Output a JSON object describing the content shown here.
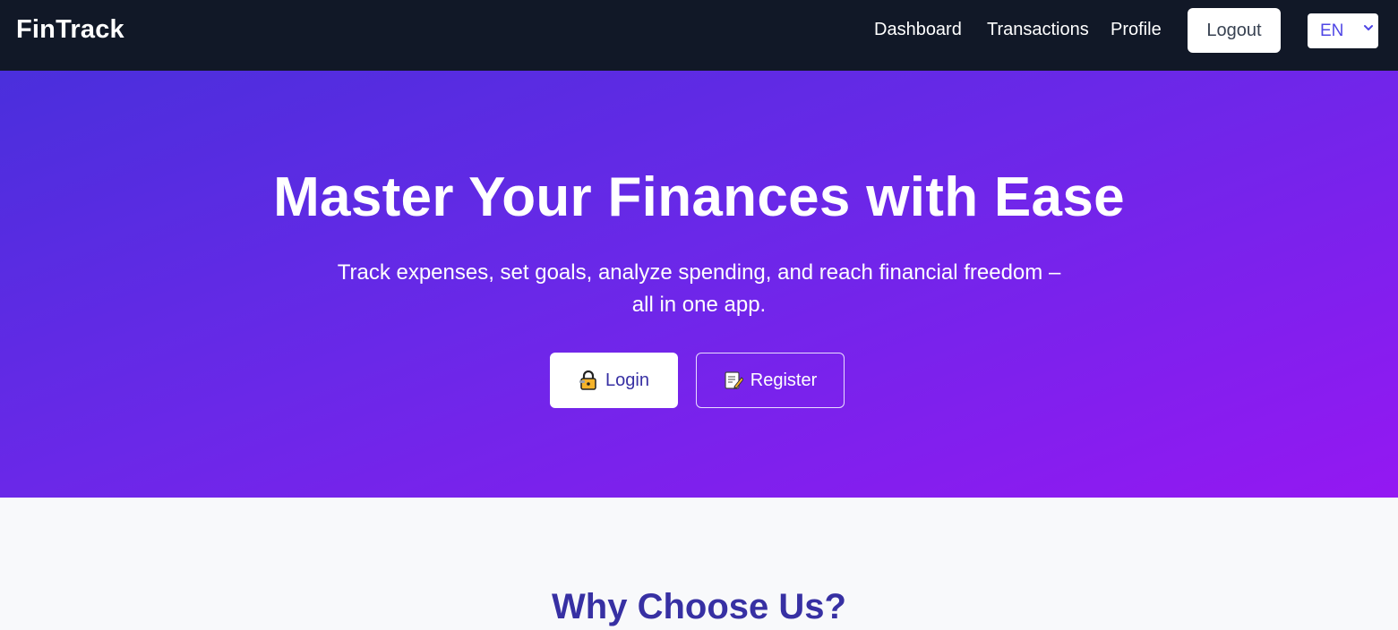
{
  "navbar": {
    "brand": "FinTrack",
    "links": {
      "dashboard": "Dashboard",
      "transactions": "Transactions",
      "profile": "Profile"
    },
    "logout_label": "Logout",
    "language": {
      "selected": "EN"
    }
  },
  "hero": {
    "title": "Master Your Finances with Ease",
    "subtitle_line1": "Track expenses, set goals, analyze spending, and reach financial freedom –",
    "subtitle_line2": "all in one app.",
    "login_label": "Login",
    "register_label": "Register"
  },
  "features": {
    "title": "Why Choose Us?"
  },
  "colors": {
    "navbar_bg": "#111827",
    "hero_gradient_start": "#4a2fdc",
    "hero_gradient_end": "#9418f2",
    "accent_text": "#3730a3",
    "features_bg": "#f8f9fb"
  },
  "icons": {
    "login": "lock-key-icon",
    "register": "memo-pencil-icon",
    "language": "chevron-down-icon"
  }
}
